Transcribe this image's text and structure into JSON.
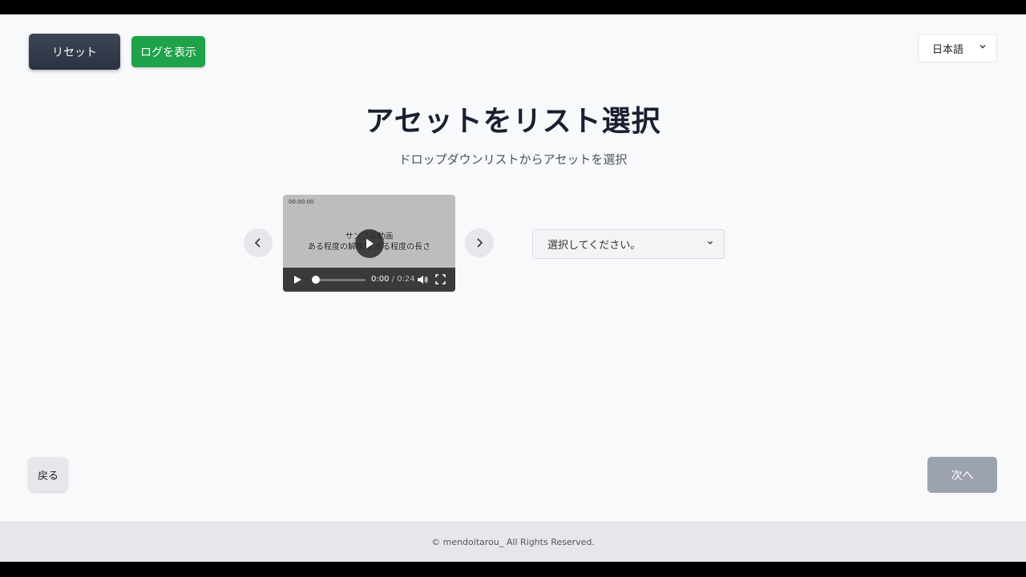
{
  "header": {
    "reset_label": "リセット",
    "log_label": "ログを表示",
    "language": "日本語"
  },
  "main": {
    "title": "アセットをリスト選択",
    "subtitle": "ドロップダウンリストからアセットを選択",
    "video": {
      "stamp": "00:00:00",
      "caption_line1": "サンプル動画",
      "caption_line2": "ある程度の解像度 ある程度の長さ",
      "current_time": "0:00",
      "separator": " / ",
      "duration": "0:24"
    },
    "select_placeholder": "選択してください。"
  },
  "navigation": {
    "back_label": "戻る",
    "next_label": "次へ"
  },
  "footer": {
    "copyright": "© mendoitarou_ All Rights Reserved."
  }
}
